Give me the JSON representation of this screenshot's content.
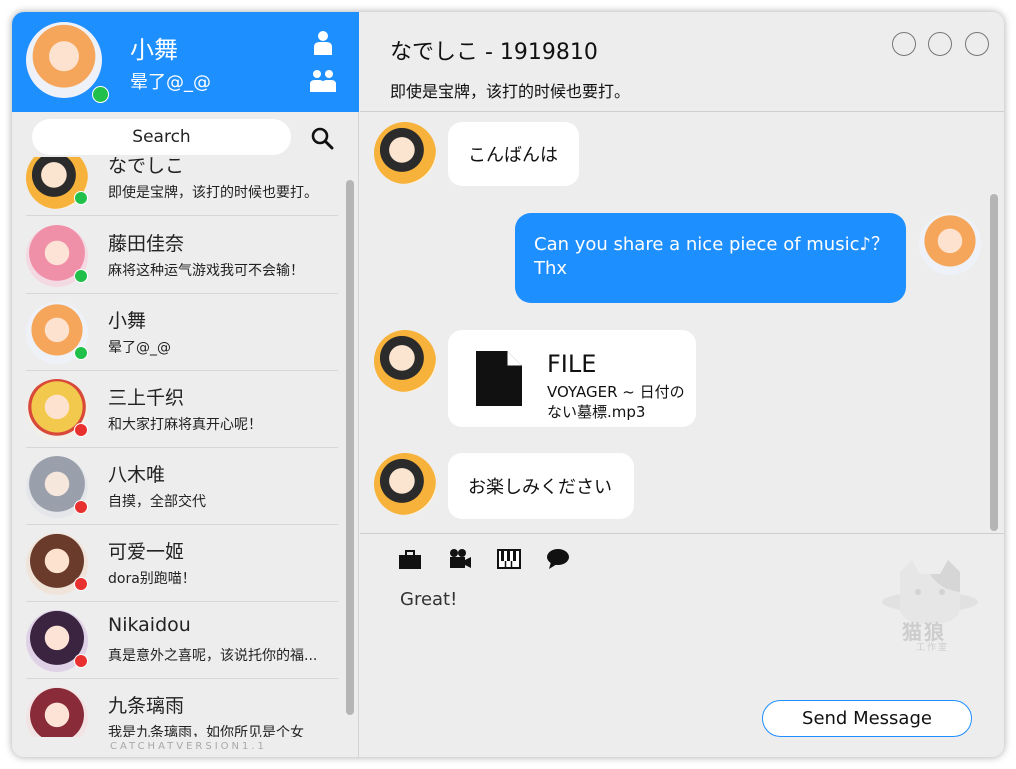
{
  "profile": {
    "name": "小舞",
    "signature": "晕了@_@",
    "status": "online"
  },
  "search": {
    "placeholder": "Search"
  },
  "contacts": [
    {
      "name": "なでしこ",
      "message": "即使是宝牌，该打的时候也要打。",
      "status": "online"
    },
    {
      "name": "藤田佳奈",
      "message": "麻将这种运气游戏我可不会输！",
      "status": "online"
    },
    {
      "name": "小舞",
      "message": "晕了@_@",
      "status": "online"
    },
    {
      "name": "三上千织",
      "message": "和大家打麻将真开心呢！",
      "status": "offline"
    },
    {
      "name": "八木唯",
      "message": "自摸，全部交代",
      "status": "offline"
    },
    {
      "name": "可爱一姬",
      "message": "dora别跑喵！",
      "status": "offline"
    },
    {
      "name": "Nikaidou",
      "message": "真是意外之喜呢，该说托你的福...",
      "status": "offline"
    },
    {
      "name": "九条璃雨",
      "message": "我是九条璃雨，如你所见是个女",
      "status": "offline"
    }
  ],
  "version": "CATCHATVERSION1.1",
  "chat": {
    "title": "なでしこ - 1919810",
    "signature": "即使是宝牌，该打的时候也要打。",
    "messages": [
      {
        "from": "them",
        "text": "こんばんは"
      },
      {
        "from": "me",
        "text": "Can you share a nice piece of music♪？Thx"
      },
      {
        "from": "them",
        "type": "file",
        "file_label": "FILE",
        "file_name": "VOYAGER ~ 日付のない墓標.mp3"
      },
      {
        "from": "them",
        "text": "お楽しみください"
      }
    ],
    "toolbar": [
      "briefcase-icon",
      "video-camera-icon",
      "piano-icon",
      "chat-bubble-icon"
    ],
    "draft": "Great!",
    "send_label": "Send Message"
  },
  "watermark": {
    "title": "猫狼",
    "subtitle": "工作室"
  },
  "colors": {
    "accent": "#1e8fff",
    "online": "#21c04a",
    "offline": "#e8312f"
  }
}
